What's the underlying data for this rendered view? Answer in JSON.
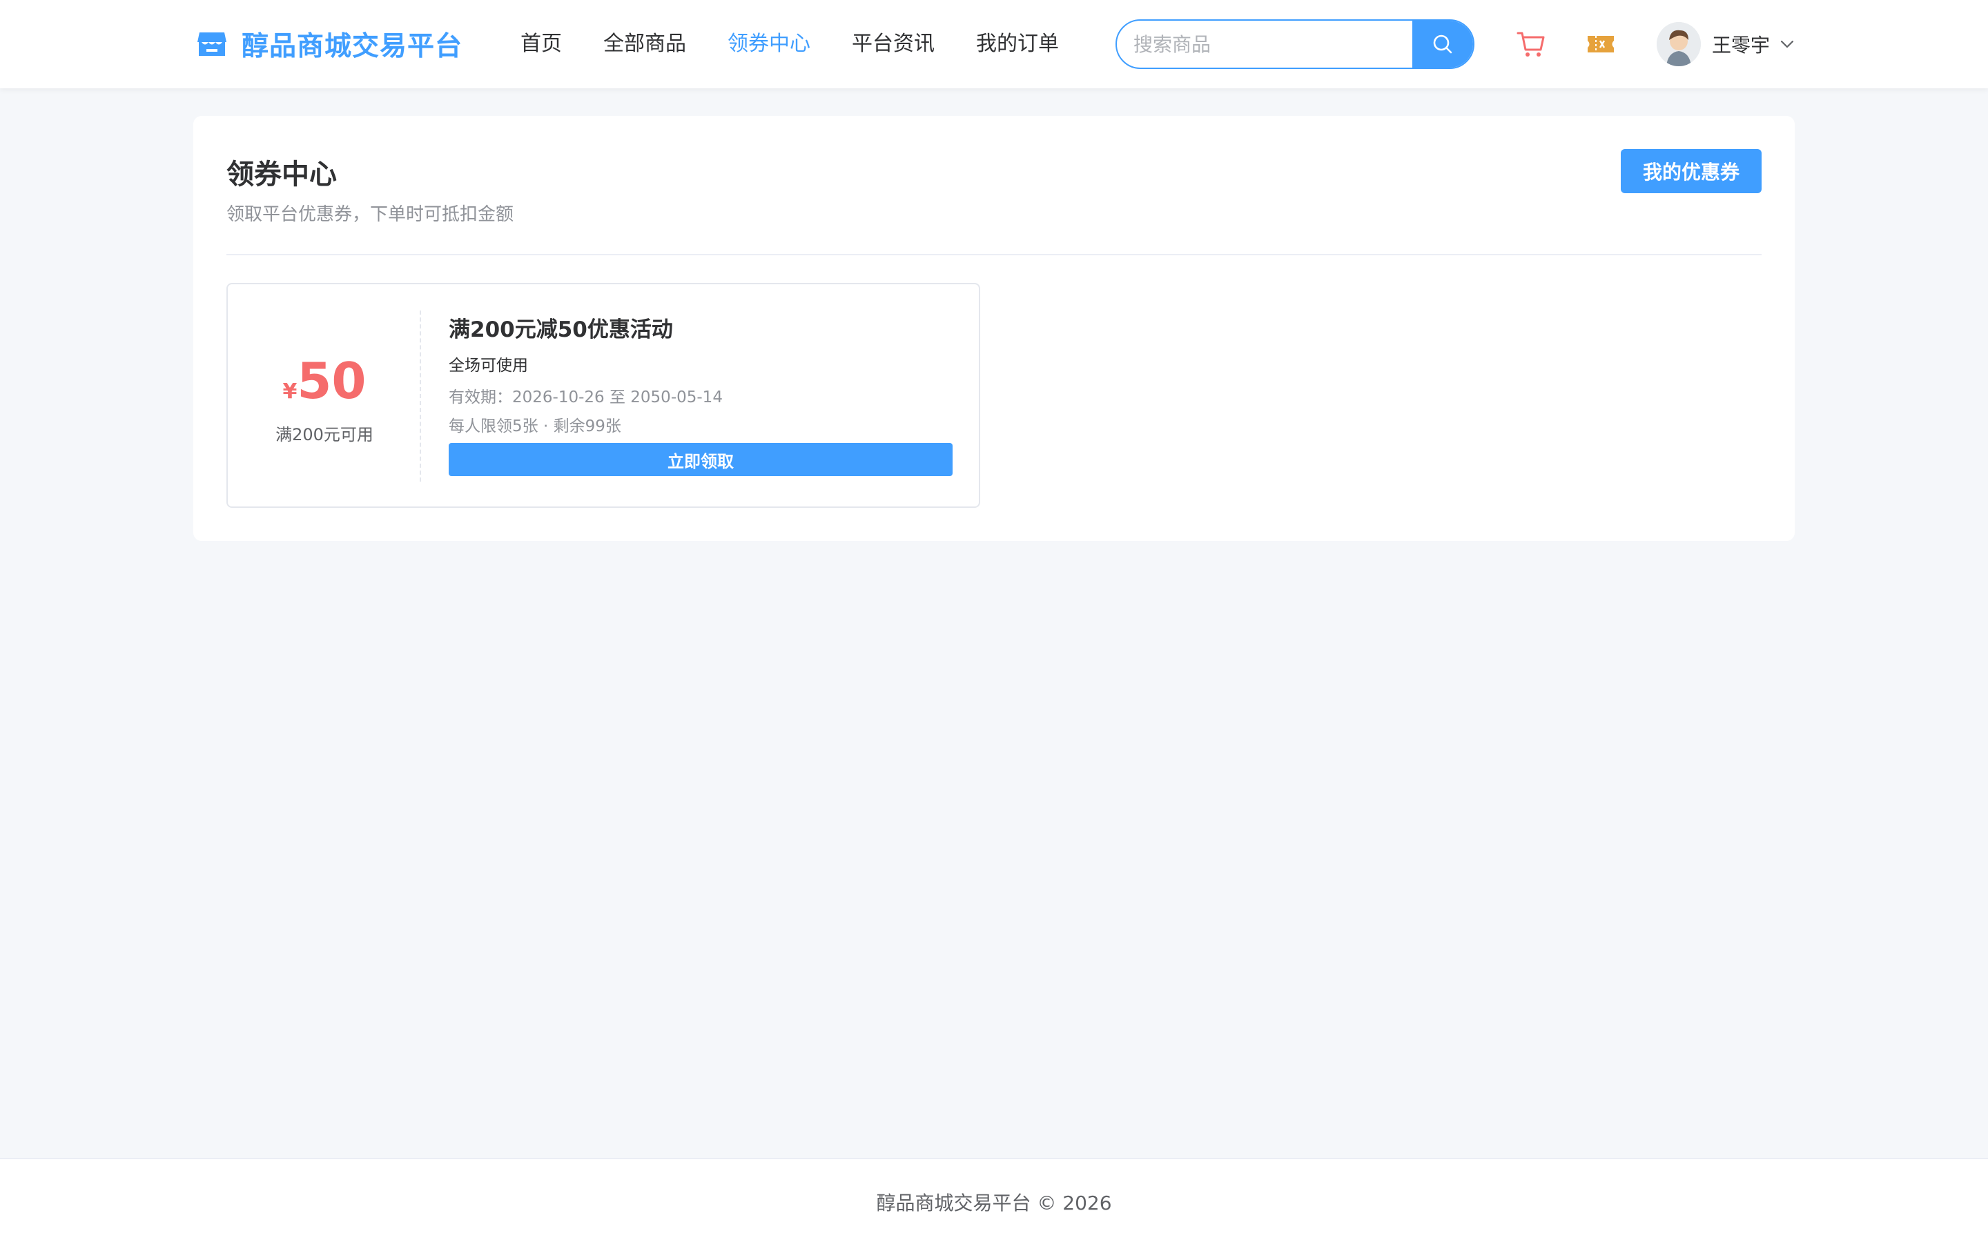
{
  "header": {
    "logo_text": "醇品商城交易平台",
    "nav": [
      {
        "label": "首页"
      },
      {
        "label": "全部商品"
      },
      {
        "label": "领券中心"
      },
      {
        "label": "平台资讯"
      },
      {
        "label": "我的订单"
      }
    ],
    "active_nav": "领券中心",
    "search_placeholder": "搜索商品",
    "user_name": "王零宇",
    "icons": [
      "logo-shop-icon",
      "search-icon",
      "cart-icon",
      "coupon-ticket-icon",
      "chevron-down-icon"
    ]
  },
  "page": {
    "title": "领券中心",
    "subtitle": "领取平台优惠券，下单时可抵扣金额",
    "my_coupons_label": "我的优惠券"
  },
  "coupons": [
    {
      "currency": "¥",
      "amount": "50",
      "condition": "满200元可用",
      "name": "满200元减50优惠活动",
      "scope": "全场可使用",
      "validity": "有效期：2026-10-26 至 2050-05-14",
      "limit": "每人限领5张 · 剩余99张",
      "claim_label": "立即领取"
    }
  ],
  "footer": {
    "text": "醇品商城交易平台 © 2026"
  },
  "colors": {
    "primary": "#409eff",
    "price": "#f56c6c",
    "cart": "#f56c6c",
    "coupon_icon": "#e6a23c",
    "background": "#f5f7fa"
  }
}
